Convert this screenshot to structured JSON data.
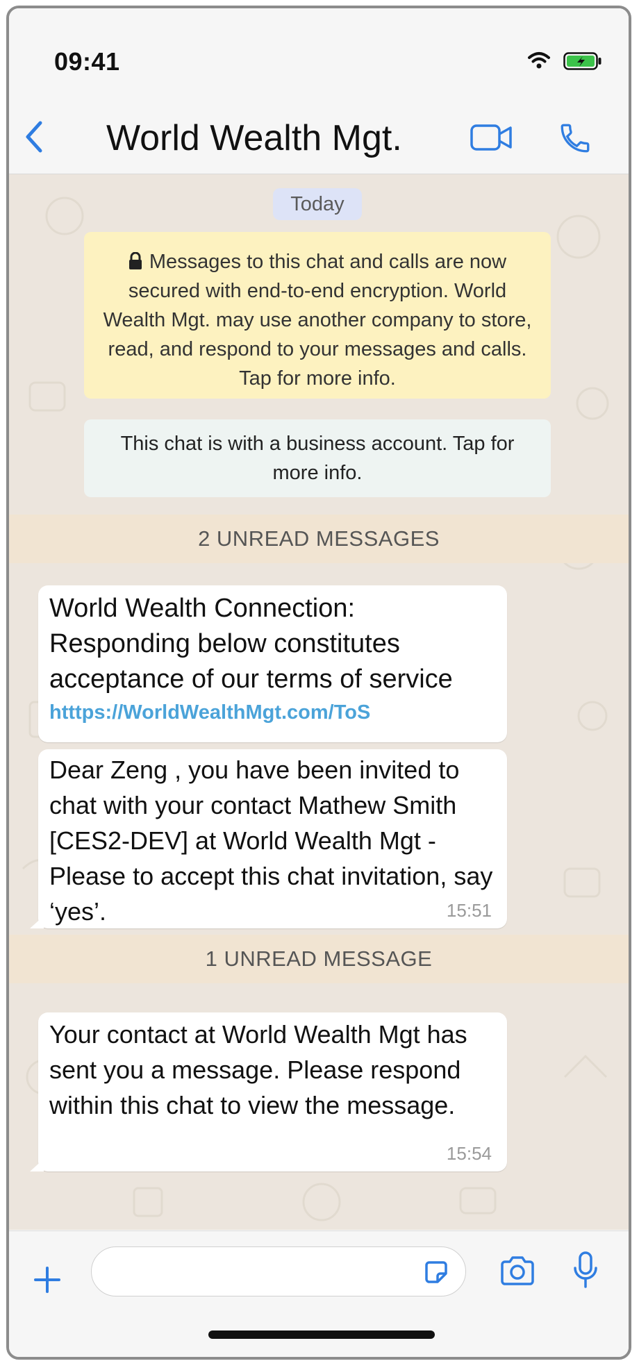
{
  "status_bar": {
    "time": "09:41"
  },
  "header": {
    "title": "World Wealth Mgt."
  },
  "chat": {
    "date_label": "Today",
    "encryption_notice": "Messages to this chat and calls are now secured with end-to-end encryption. World Wealth Mgt. may use another company to store, read, and respond to your messages and calls. Tap for more info.",
    "business_notice": "This chat is with a business account. Tap for more info.",
    "unread_banner_1": "2 UNREAD MESSAGES",
    "unread_banner_2": "1 UNREAD MESSAGE",
    "messages": [
      {
        "text": "World Wealth Connection: Responding below constitutes acceptance of our terms of service",
        "link": "htttps://WorldWealthMgt.com/ToS"
      },
      {
        "text": "Dear Zeng , you have been invited to chat with your contact Mathew Smith [CES2-DEV] at World Wealth Mgt - Please to accept this chat invitation, say ‘yes’.",
        "time": "15:51"
      },
      {
        "text": "Your contact at World Wealth Mgt has sent you a message. Please respond within this chat to view the message.",
        "time": "15:54"
      }
    ]
  },
  "input_bar": {
    "placeholder": ""
  },
  "colors": {
    "accent": "#2f7de1",
    "chat_background": "#ece5dd",
    "encryption_notice_bg": "#fdf2c0",
    "unread_banner_bg": "#f1e4d2",
    "date_pill_bg": "#dde3f7",
    "link": "#4ba3d9",
    "battery_green": "#3cc24a"
  },
  "icons": [
    "back-chevron-icon",
    "video-call-icon",
    "phone-call-icon",
    "wifi-icon",
    "battery-icon",
    "lock-icon",
    "plus-icon",
    "sticker-icon",
    "camera-icon",
    "microphone-icon"
  ]
}
